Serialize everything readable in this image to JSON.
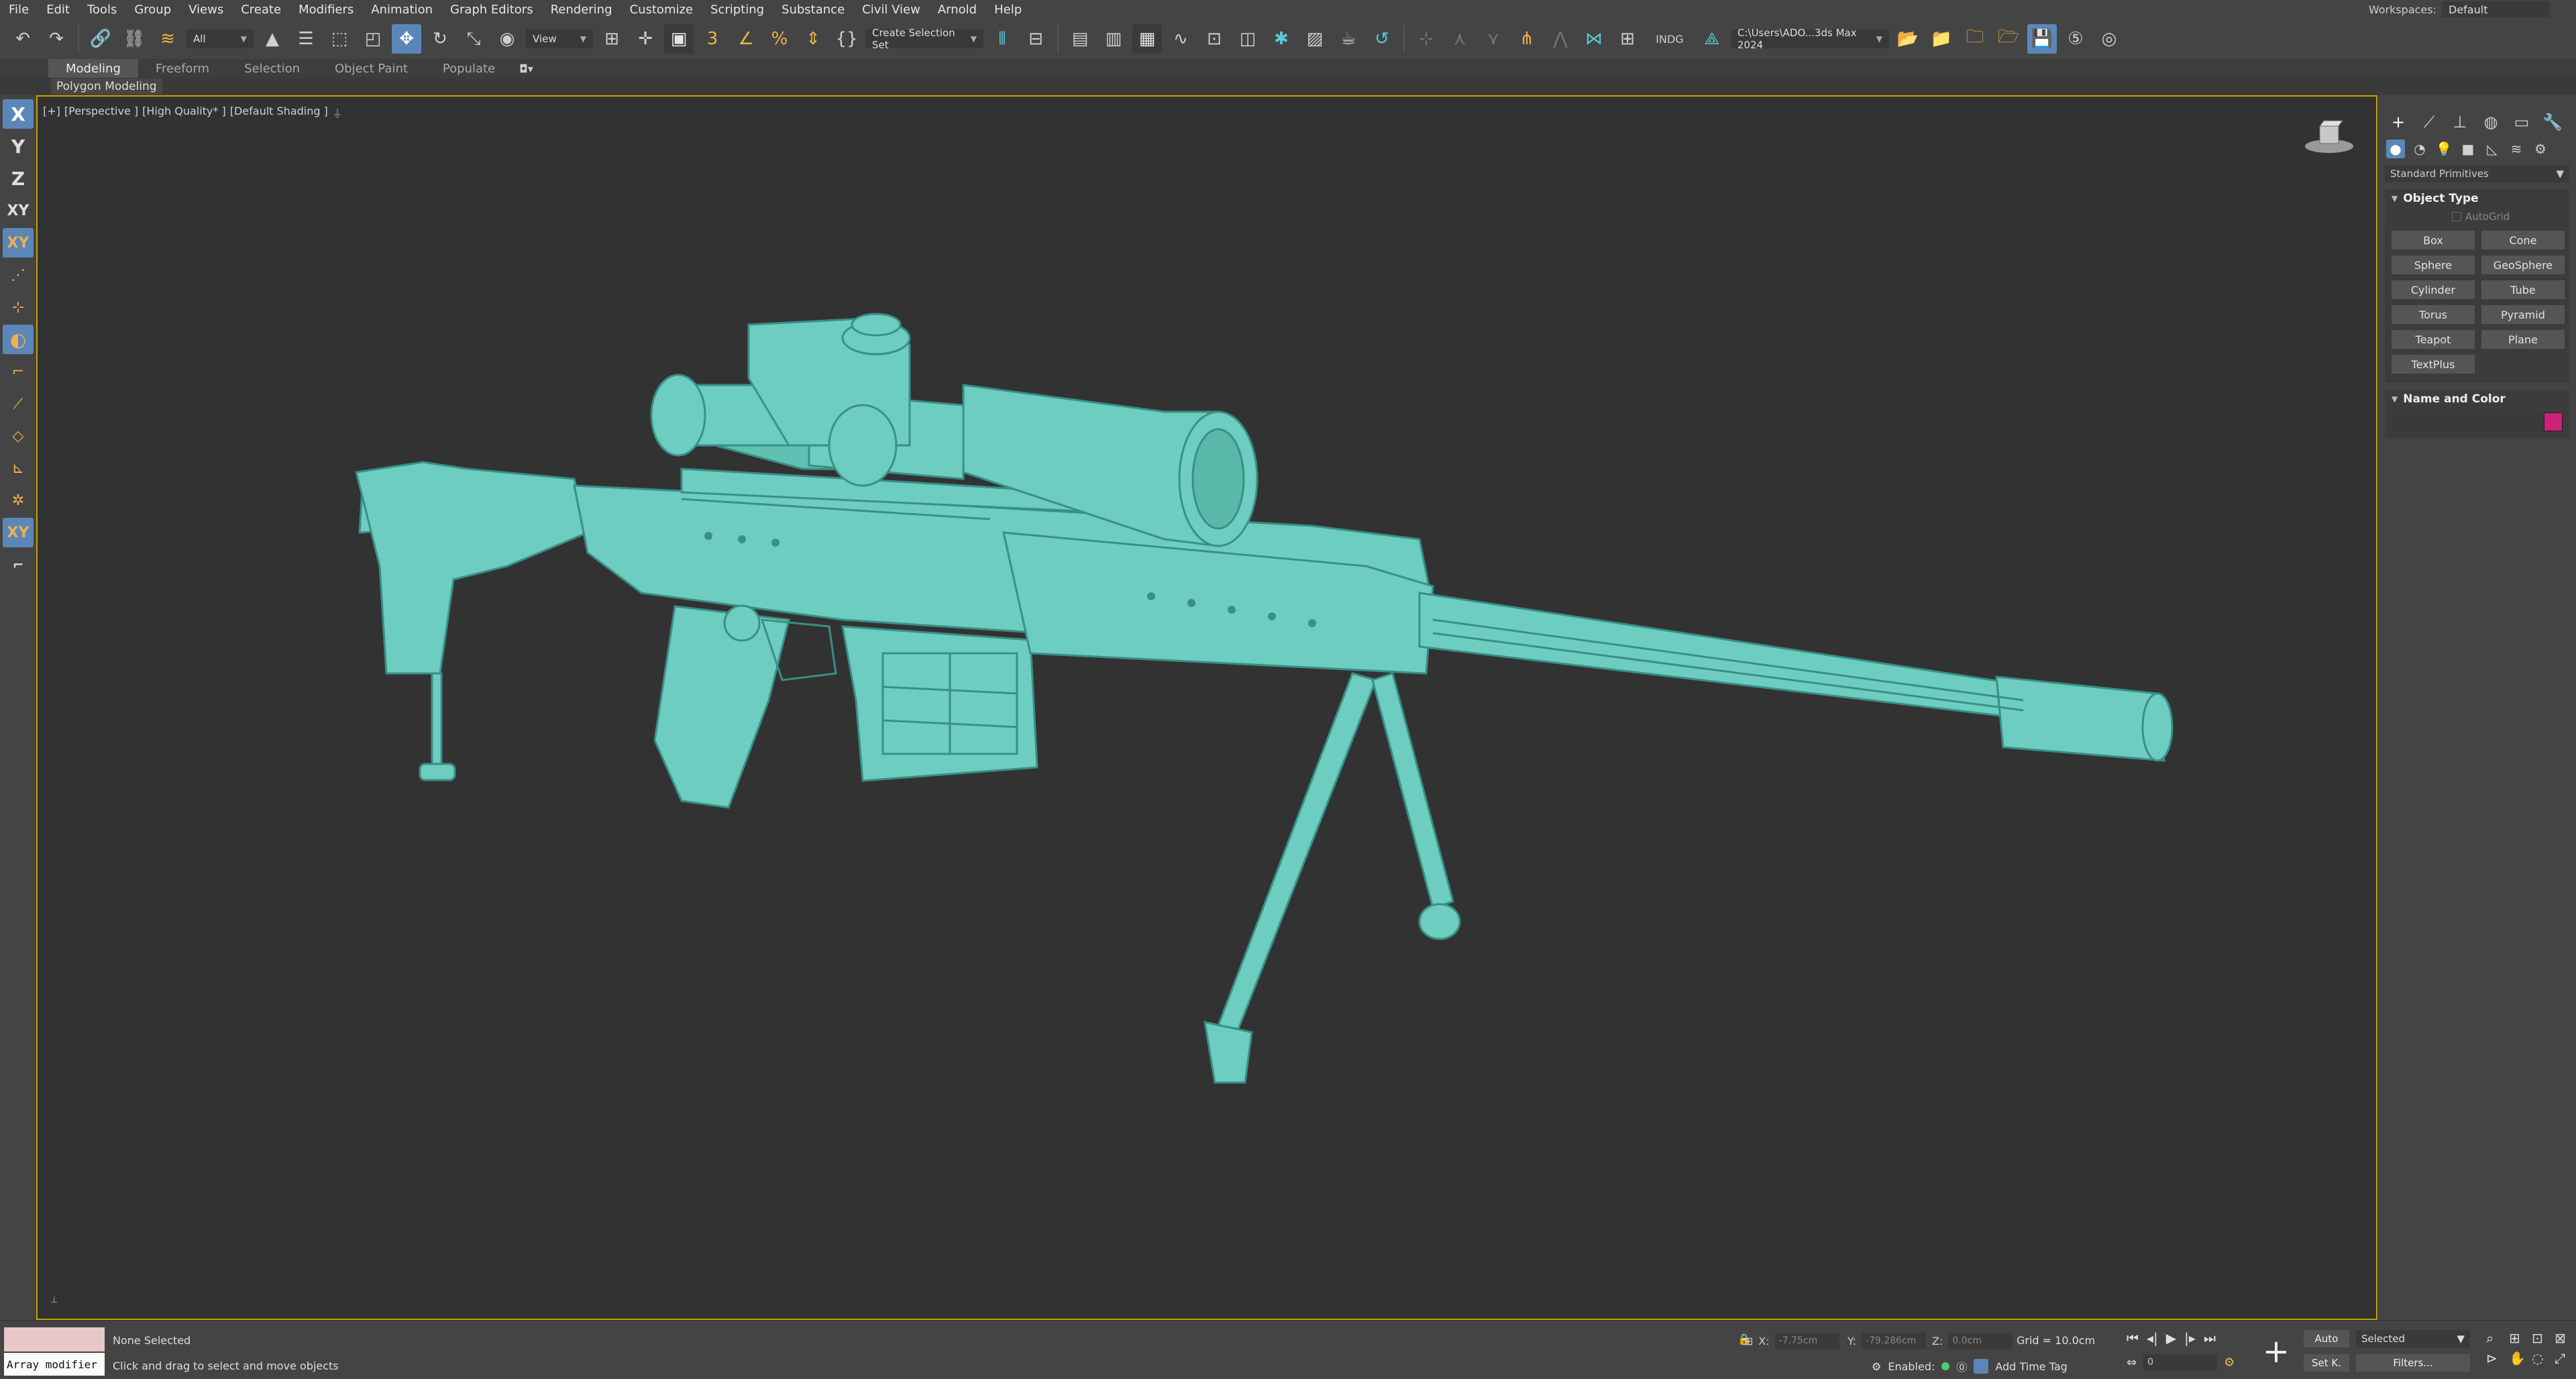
{
  "menubar": {
    "items": [
      "File",
      "Edit",
      "Tools",
      "Group",
      "Views",
      "Create",
      "Modifiers",
      "Animation",
      "Graph Editors",
      "Rendering",
      "Customize",
      "Scripting",
      "Substance",
      "Civil View",
      "Arnold",
      "Help"
    ],
    "workspace_label": "Workspaces:",
    "workspace_value": "Default"
  },
  "toolbar": {
    "filter_value": "All",
    "coord_system": "View",
    "selection_set": "Create Selection Set",
    "indg_label": "INDG",
    "project_path": "C:\\Users\\ADO...3ds Max 2024"
  },
  "ribbon": {
    "tabs": [
      "Modeling",
      "Freeform",
      "Selection",
      "Object Paint",
      "Populate"
    ],
    "active_tab": "Modeling",
    "sub_label": "Polygon Modeling"
  },
  "leftbar": {
    "axis_labels": [
      "X",
      "Y",
      "Z",
      "XY",
      "XY"
    ]
  },
  "viewport": {
    "labels": [
      "[+]",
      "[Perspective ]",
      "[High Quality* ]",
      "[Default Shading ]"
    ],
    "model_color": "#6ccdc0",
    "background": "#323232"
  },
  "command_panel": {
    "category": "Standard Primitives",
    "object_type_title": "Object Type",
    "autogrid_label": "AutoGrid",
    "primitives": [
      "Box",
      "Cone",
      "Sphere",
      "GeoSphere",
      "Cylinder",
      "Tube",
      "Torus",
      "Pyramid",
      "Teapot",
      "Plane",
      "TextPlus"
    ],
    "name_color_title": "Name and Color",
    "object_color": "#d0207a"
  },
  "status": {
    "maxscript_value": "Array modifier",
    "selection": "None Selected",
    "prompt": "Click and drag to select and move objects",
    "x_label": "X:",
    "x_value": "-7.75cm",
    "y_label": "Y:",
    "y_value": "-79.286cm",
    "z_label": "Z:",
    "z_value": "0.0cm",
    "grid": "Grid = 10.0cm",
    "enabled_label": "Enabled:",
    "add_time_tag": "Add Time Tag",
    "frame_value": "0",
    "auto_label": "Auto",
    "setk_label": "Set K.",
    "selected_value": "Selected",
    "filters_label": "Filters..."
  }
}
